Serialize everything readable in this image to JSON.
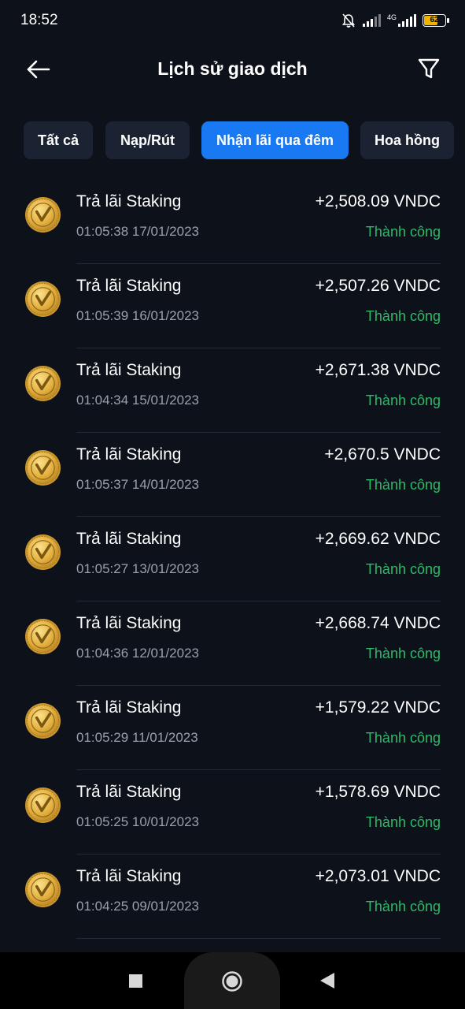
{
  "status_bar": {
    "time": "18:52",
    "network": "4G",
    "battery": "62"
  },
  "header": {
    "title": "Lịch sử giao dịch"
  },
  "tabs": [
    {
      "label": "Tất cả",
      "active": false
    },
    {
      "label": "Nạp/Rút",
      "active": false
    },
    {
      "label": "Nhận lãi qua đêm",
      "active": true
    },
    {
      "label": "Hoa hồng",
      "active": false
    }
  ],
  "transactions": [
    {
      "title": "Trả lãi Staking",
      "time": "01:05:38 17/01/2023",
      "amount": "+2,508.09 VNDC",
      "status": "Thành công"
    },
    {
      "title": "Trả lãi Staking",
      "time": "01:05:39 16/01/2023",
      "amount": "+2,507.26 VNDC",
      "status": "Thành công"
    },
    {
      "title": "Trả lãi Staking",
      "time": "01:04:34 15/01/2023",
      "amount": "+2,671.38 VNDC",
      "status": "Thành công"
    },
    {
      "title": "Trả lãi Staking",
      "time": "01:05:37 14/01/2023",
      "amount": "+2,670.5 VNDC",
      "status": "Thành công"
    },
    {
      "title": "Trả lãi Staking",
      "time": "01:05:27 13/01/2023",
      "amount": "+2,669.62 VNDC",
      "status": "Thành công"
    },
    {
      "title": "Trả lãi Staking",
      "time": "01:04:36 12/01/2023",
      "amount": "+2,668.74 VNDC",
      "status": "Thành công"
    },
    {
      "title": "Trả lãi Staking",
      "time": "01:05:29 11/01/2023",
      "amount": "+1,579.22 VNDC",
      "status": "Thành công"
    },
    {
      "title": "Trả lãi Staking",
      "time": "01:05:25 10/01/2023",
      "amount": "+1,578.69 VNDC",
      "status": "Thành công"
    },
    {
      "title": "Trả lãi Staking",
      "time": "01:04:25 09/01/2023",
      "amount": "+2,073.01 VNDC",
      "status": "Thành công"
    }
  ],
  "colors": {
    "background": "#0d111a",
    "tab_background": "#1b2231",
    "tab_active": "#1879f2",
    "success": "#2dbb6a",
    "muted_text": "#9aa0aa",
    "coin_gold": "#e9b53d"
  },
  "icons": {
    "back": "arrow-left-icon",
    "filter": "funnel-icon",
    "coin": "vndc-coin-icon",
    "nav_recent": "square-icon",
    "nav_home": "circle-icon",
    "nav_back": "triangle-left-icon"
  }
}
